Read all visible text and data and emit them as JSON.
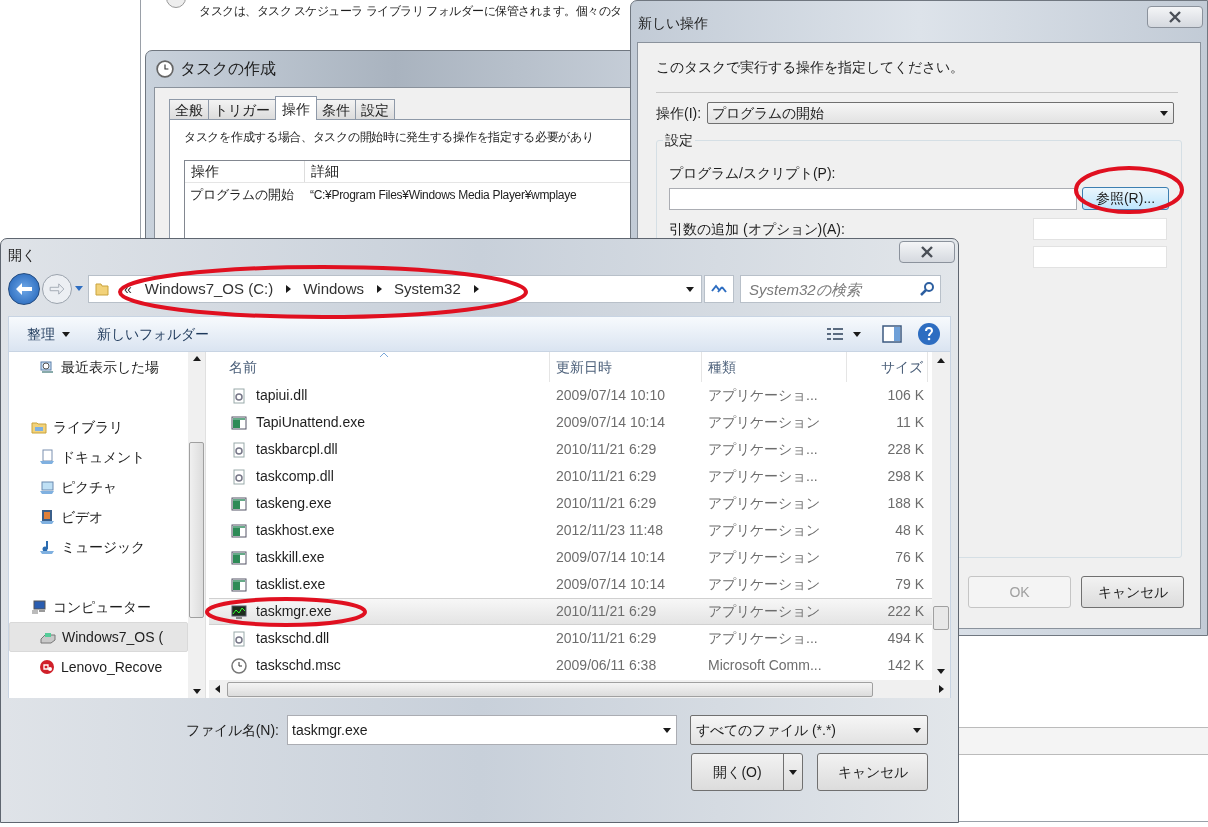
{
  "scheduler_window": {
    "description": "タスクは、タスク スケジューラ ライブラリ フォルダーに保管されます。個々のタ"
  },
  "create_task_window": {
    "title": "タスクの作成",
    "tabs": [
      {
        "label": "全般",
        "selected": false
      },
      {
        "label": "トリガー",
        "selected": false
      },
      {
        "label": "操作",
        "selected": true
      },
      {
        "label": "条件",
        "selected": false
      },
      {
        "label": "設定",
        "selected": false
      }
    ],
    "instruction": "タスクを作成する場合、タスクの開始時に発生する操作を指定する必要があり",
    "table": {
      "columns": [
        "操作",
        "詳細"
      ],
      "rows": [
        [
          "プログラムの開始",
          "“C:¥Program Files¥Windows Media Player¥wmplaye"
        ]
      ]
    }
  },
  "new_action_dialog": {
    "title": "新しい操作",
    "instruction": "このタスクで実行する操作を指定してください。",
    "action_label": "操作(I):",
    "action_value": "プログラムの開始",
    "group_title": "設定",
    "program_label": "プログラム/スクリプト(P):",
    "browse_button": "参照(R)...",
    "arguments_label": "引数の追加 (オプション)(A):",
    "buttons": [
      {
        "label": "OK",
        "disabled": true
      },
      {
        "label": "キャンセル",
        "disabled": false
      }
    ]
  },
  "open_dialog": {
    "title": "開く",
    "address": {
      "overflow": "«",
      "segments": [
        "Windows7_OS (C:)",
        "Windows",
        "System32"
      ]
    },
    "search": {
      "placeholder": "System32の検索"
    },
    "toolbar": [
      "整理",
      "新しいフォルダー"
    ],
    "nav_pane": {
      "groups": [
        {
          "children": [
            {
              "label": "最近表示した場",
              "kind": "recent",
              "selected": false
            }
          ]
        },
        {
          "label": "ライブラリ",
          "kind": "library",
          "selected": false,
          "children": [
            {
              "label": "ドキュメント",
              "kind": "document",
              "selected": false
            },
            {
              "label": "ピクチャ",
              "kind": "picture",
              "selected": false
            },
            {
              "label": "ビデオ",
              "kind": "video",
              "selected": false
            },
            {
              "label": "ミュージック",
              "kind": "music",
              "selected": false
            }
          ]
        },
        {
          "label": "コンピューター",
          "kind": "computer",
          "selected": false,
          "children": [
            {
              "label": "Windows7_OS (",
              "kind": "drive",
              "selected": true
            },
            {
              "label": "Lenovo_Recove",
              "kind": "recovery",
              "selected": false
            }
          ]
        }
      ]
    },
    "file_list": {
      "columns": [
        "名前",
        "更新日時",
        "種類",
        "サイズ"
      ],
      "rows": [
        {
          "name": "tapiui.dll",
          "kind": "dll",
          "date": "2009/07/14 10:10",
          "type": "アプリケーショ...",
          "size": "106 K",
          "selected": false
        },
        {
          "name": "TapiUnattend.exe",
          "kind": "exe",
          "date": "2009/07/14 10:14",
          "type": "アプリケーション",
          "size": "11 K",
          "selected": false
        },
        {
          "name": "taskbarcpl.dll",
          "kind": "dll",
          "date": "2010/11/21 6:29",
          "type": "アプリケーショ...",
          "size": "228 K",
          "selected": false
        },
        {
          "name": "taskcomp.dll",
          "kind": "dll",
          "date": "2010/11/21 6:29",
          "type": "アプリケーショ...",
          "size": "298 K",
          "selected": false
        },
        {
          "name": "taskeng.exe",
          "kind": "exe",
          "date": "2010/11/21 6:29",
          "type": "アプリケーション",
          "size": "188 K",
          "selected": false
        },
        {
          "name": "taskhost.exe",
          "kind": "exe",
          "date": "2012/11/23 11:48",
          "type": "アプリケーション",
          "size": "48 K",
          "selected": false
        },
        {
          "name": "taskkill.exe",
          "kind": "exe",
          "date": "2009/07/14 10:14",
          "type": "アプリケーション",
          "size": "76 K",
          "selected": false
        },
        {
          "name": "tasklist.exe",
          "kind": "exe",
          "date": "2009/07/14 10:14",
          "type": "アプリケーション",
          "size": "79 K",
          "selected": false
        },
        {
          "name": "taskmgr.exe",
          "kind": "monitor",
          "date": "2010/11/21 6:29",
          "type": "アプリケーション",
          "size": "222 K",
          "selected": true
        },
        {
          "name": "taskschd.dll",
          "kind": "dll",
          "date": "2010/11/21 6:29",
          "type": "アプリケーショ...",
          "size": "494 K",
          "selected": false
        },
        {
          "name": "taskschd.msc",
          "kind": "clock",
          "date": "2009/06/11 6:38",
          "type": "Microsoft Comm...",
          "size": "142 K",
          "selected": false
        }
      ]
    },
    "filename_label": "ファイル名(N):",
    "filename_value": "taskmgr.exe",
    "filter": "すべてのファイル (*.*)",
    "buttons": [
      {
        "label": "開く(O)",
        "kind": "split"
      },
      {
        "label": "キャンセル",
        "kind": "plain"
      }
    ]
  }
}
